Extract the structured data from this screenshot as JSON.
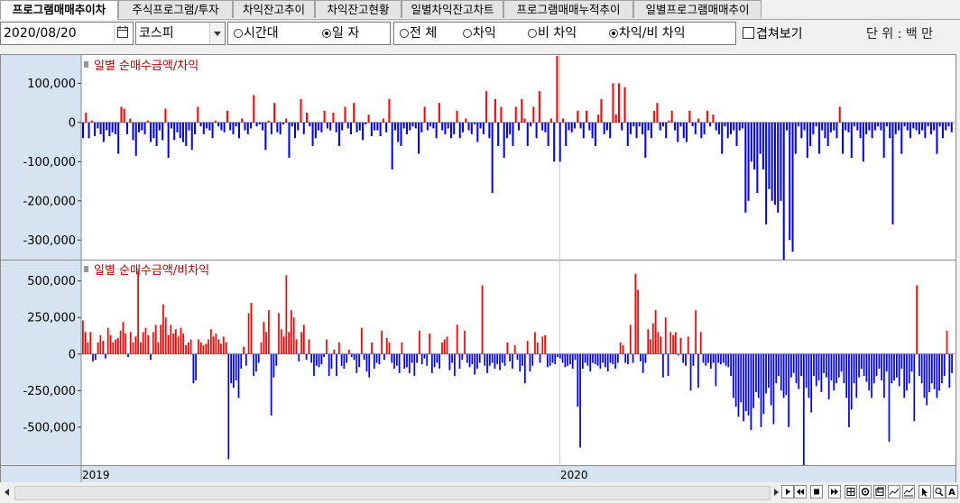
{
  "tabs": [
    {
      "label": "프로그램매매추이차",
      "active": true
    },
    {
      "label": "주식프로그램/투자",
      "active": false
    },
    {
      "label": "차익잔고추이",
      "active": false
    },
    {
      "label": "차익잔고현황",
      "active": false
    },
    {
      "label": "일별차익잔고차트",
      "active": false
    },
    {
      "label": "프로그램매매누적추이",
      "active": false
    },
    {
      "label": "일별프로그램매매추이",
      "active": false
    }
  ],
  "toolbar": {
    "date": "2020/08/20",
    "market": "코스피",
    "period_options": [
      {
        "label": "시간대",
        "selected": false
      },
      {
        "label": "일 자",
        "selected": true
      }
    ],
    "type_options": [
      {
        "label": "전 체",
        "selected": false
      },
      {
        "label": "차익",
        "selected": false
      },
      {
        "label": "비 차익",
        "selected": false
      },
      {
        "label": "차익/비 차익",
        "selected": true
      }
    ],
    "overlay_label": "겹쳐보기",
    "overlay_checked": false,
    "unit_label": "단 위 : 백 만"
  },
  "colors": {
    "positive": "#ff0000",
    "negative": "#0000ff",
    "axis_bg": "#d6e3f0"
  },
  "x_axis_labels": [
    "2019",
    "2020"
  ],
  "chart_data": [
    {
      "type": "bar",
      "title": "일별 순매수금액/차익",
      "yticks": [
        "100,000",
        "0",
        "-100,000",
        "-200,000",
        "-300,000"
      ],
      "ylim": [
        -350000,
        170000
      ],
      "values": [
        -40000,
        25000,
        -40000,
        5000,
        -35000,
        -15000,
        -30000,
        -50000,
        -20000,
        -35000,
        -25000,
        -30000,
        -80000,
        40000,
        35000,
        -30000,
        10000,
        -45000,
        -85000,
        -25000,
        -20000,
        -30000,
        5000,
        -50000,
        -40000,
        -60000,
        -20000,
        -45000,
        35000,
        -90000,
        -15000,
        -45000,
        -25000,
        -40000,
        -50000,
        -60000,
        -20000,
        -70000,
        -30000,
        40000,
        -10000,
        -30000,
        -15000,
        -20000,
        -40000,
        5000,
        -10000,
        -20000,
        -25000,
        30000,
        -20000,
        -30000,
        -10000,
        -40000,
        10000,
        -20000,
        -30000,
        -15000,
        70000,
        -10000,
        -5000,
        -20000,
        -70000,
        5000,
        -30000,
        50000,
        -25000,
        -30000,
        -5000,
        10000,
        -90000,
        -10000,
        -40000,
        -20000,
        60000,
        -30000,
        25000,
        -10000,
        -60000,
        -40000,
        -20000,
        -25000,
        30000,
        -15000,
        -20000,
        25000,
        -25000,
        -60000,
        -20000,
        40000,
        -15000,
        -30000,
        50000,
        -25000,
        -20000,
        -45000,
        -5000,
        20000,
        -35000,
        -20000,
        -20000,
        -35000,
        10000,
        -25000,
        60000,
        -120000,
        -20000,
        -50000,
        -60000,
        -15000,
        -30000,
        -20000,
        -10000,
        -15000,
        -80000,
        -25000,
        40000,
        -20000,
        -10000,
        -15000,
        -40000,
        50000,
        -20000,
        -30000,
        -15000,
        -40000,
        -30000,
        30000,
        -40000,
        -25000,
        10000,
        -20000,
        -30000,
        -5000,
        -50000,
        -15000,
        -30000,
        80000,
        -40000,
        -180000,
        60000,
        -60000,
        40000,
        -90000,
        -40000,
        -30000,
        -60000,
        40000,
        -20000,
        60000,
        10000,
        -60000,
        -10000,
        40000,
        -40000,
        80000,
        -20000,
        -25000,
        -60000,
        10000,
        -100000,
        170000,
        -100000,
        10000,
        -60000,
        -20000,
        -25000,
        -15000,
        30000,
        -15000,
        -40000,
        30000,
        -20000,
        -40000,
        -60000,
        20000,
        60000,
        -30000,
        -20000,
        -40000,
        100000,
        20000,
        100000,
        -20000,
        90000,
        -60000,
        -30000,
        -10000,
        -40000,
        -10000,
        -30000,
        -90000,
        -20000,
        -40000,
        30000,
        50000,
        -20000,
        -10000,
        -40000,
        5000,
        30000,
        -20000,
        -50000,
        -10000,
        -40000,
        -50000,
        30000,
        -10000,
        -30000,
        10000,
        -40000,
        -30000,
        30000,
        -10000,
        20000,
        -20000,
        -30000,
        -80000,
        -10000,
        -40000,
        -30000,
        -20000,
        -60000,
        -20000,
        -15000,
        -230000,
        -200000,
        -100000,
        -120000,
        -180000,
        -80000,
        -120000,
        -260000,
        -170000,
        -200000,
        -210000,
        -230000,
        -200000,
        -350000,
        -20000,
        -300000,
        -330000,
        -80000,
        -10000,
        -40000,
        -20000,
        -90000,
        -60000,
        -30000,
        -10000,
        -80000,
        -20000,
        -40000,
        -60000,
        -25000,
        -20000,
        -40000,
        40000,
        -80000,
        -20000,
        -25000,
        -90000,
        -10000,
        -20000,
        -40000,
        -100000,
        -30000,
        -20000,
        -40000,
        -20000,
        -10000,
        -20000,
        -90000,
        -10000,
        -40000,
        -260000,
        -30000,
        -20000,
        -80000,
        -10000,
        -20000,
        -40000,
        -15000,
        -20000,
        -30000,
        -20000,
        -40000,
        -10000,
        -30000,
        -20000,
        -80000,
        -10000,
        -40000,
        -20000,
        -10000,
        -25000
      ]
    },
    {
      "type": "bar",
      "title": "일별 순매수금액/비차익",
      "yticks": [
        "500,000",
        "250,000",
        "0",
        "-250,000",
        "-500,000"
      ],
      "ylim": [
        -760000,
        640000
      ],
      "values": [
        230000,
        150000,
        80000,
        150000,
        -50000,
        -40000,
        80000,
        130000,
        90000,
        -30000,
        180000,
        130000,
        80000,
        100000,
        110000,
        160000,
        220000,
        140000,
        -20000,
        150000,
        80000,
        120000,
        570000,
        80000,
        150000,
        180000,
        130000,
        -40000,
        150000,
        200000,
        80000,
        200000,
        340000,
        250000,
        130000,
        200000,
        140000,
        170000,
        120000,
        180000,
        140000,
        60000,
        80000,
        100000,
        -200000,
        -180000,
        100000,
        80000,
        60000,
        70000,
        100000,
        170000,
        120000,
        140000,
        100000,
        70000,
        120000,
        80000,
        -720000,
        -200000,
        -230000,
        -180000,
        -300000,
        -100000,
        50000,
        -80000,
        280000,
        350000,
        -150000,
        -120000,
        -60000,
        80000,
        220000,
        150000,
        300000,
        -420000,
        -160000,
        -80000,
        280000,
        170000,
        120000,
        540000,
        150000,
        300000,
        250000,
        100000,
        -50000,
        150000,
        200000,
        -40000,
        100000,
        -60000,
        -150000,
        -80000,
        -90000,
        -70000,
        -20000,
        100000,
        -150000,
        -100000,
        30000,
        -150000,
        80000,
        -80000,
        -100000,
        -60000,
        30000,
        -20000,
        -40000,
        -130000,
        -90000,
        180000,
        -40000,
        -120000,
        -160000,
        80000,
        -100000,
        -60000,
        -70000,
        160000,
        -40000,
        110000,
        80000,
        -60000,
        -100000,
        -80000,
        -130000,
        80000,
        -100000,
        -90000,
        -130000,
        -60000,
        -150000,
        -60000,
        160000,
        -70000,
        -30000,
        -80000,
        140000,
        -130000,
        -90000,
        -60000,
        -100000,
        80000,
        100000,
        120000,
        -110000,
        -60000,
        -150000,
        200000,
        -100000,
        -40000,
        160000,
        -60000,
        -90000,
        -70000,
        -140000,
        -100000,
        -60000,
        470000,
        -80000,
        -130000,
        -80000,
        -60000,
        -100000,
        -70000,
        -110000,
        -60000,
        -80000,
        80000,
        -50000,
        -100000,
        60000,
        -40000,
        -120000,
        -80000,
        -200000,
        90000,
        -120000,
        -80000,
        150000,
        80000,
        -60000,
        120000,
        130000,
        -90000,
        -80000,
        -60000,
        -70000,
        -20000,
        -30000,
        -60000,
        -90000,
        -80000,
        -70000,
        -100000,
        -40000,
        -360000,
        -640000,
        -100000,
        -60000,
        -80000,
        -120000,
        -60000,
        -70000,
        -80000,
        -100000,
        -60000,
        -90000,
        -120000,
        -60000,
        -70000,
        -100000,
        -60000,
        80000,
        60000,
        -60000,
        -70000,
        200000,
        -60000,
        550000,
        440000,
        -50000,
        -130000,
        -60000,
        170000,
        100000,
        210000,
        300000,
        150000,
        120000,
        -160000,
        250000,
        -150000,
        150000,
        130000,
        150000,
        -10000,
        110000,
        -60000,
        -80000,
        120000,
        -250000,
        -80000,
        300000,
        -230000,
        150000,
        -60000,
        -80000,
        -60000,
        -100000,
        -60000,
        -220000,
        -60000,
        -70000,
        -60000,
        -80000,
        -90000,
        -150000,
        -300000,
        -360000,
        -430000,
        -330000,
        -460000,
        -390000,
        -420000,
        -520000,
        -370000,
        -260000,
        -300000,
        -500000,
        -410000,
        -270000,
        -230000,
        -350000,
        -480000,
        -200000,
        -150000,
        -250000,
        -300000,
        -280000,
        -500000,
        -160000,
        -130000,
        -200000,
        -240000,
        -150000,
        -760000,
        -230000,
        -300000,
        -400000,
        -150000,
        -220000,
        -180000,
        -260000,
        -130000,
        -160000,
        -310000,
        -180000,
        -250000,
        -200000,
        -160000,
        -120000,
        -200000,
        -300000,
        -500000,
        -380000,
        -200000,
        -300000,
        -160000,
        -100000,
        -150000,
        -190000,
        -250000,
        -300000,
        -200000,
        -150000,
        -100000,
        -180000,
        -300000,
        -120000,
        -600000,
        -200000,
        -180000,
        -160000,
        -220000,
        -100000,
        -300000,
        -250000,
        -200000,
        -120000,
        -460000,
        470000,
        -150000,
        -200000,
        -300000,
        -350000,
        -260000,
        -200000,
        -240000,
        -300000,
        -250000,
        -200000,
        -150000,
        160000,
        -230000,
        -130000
      ]
    }
  ]
}
